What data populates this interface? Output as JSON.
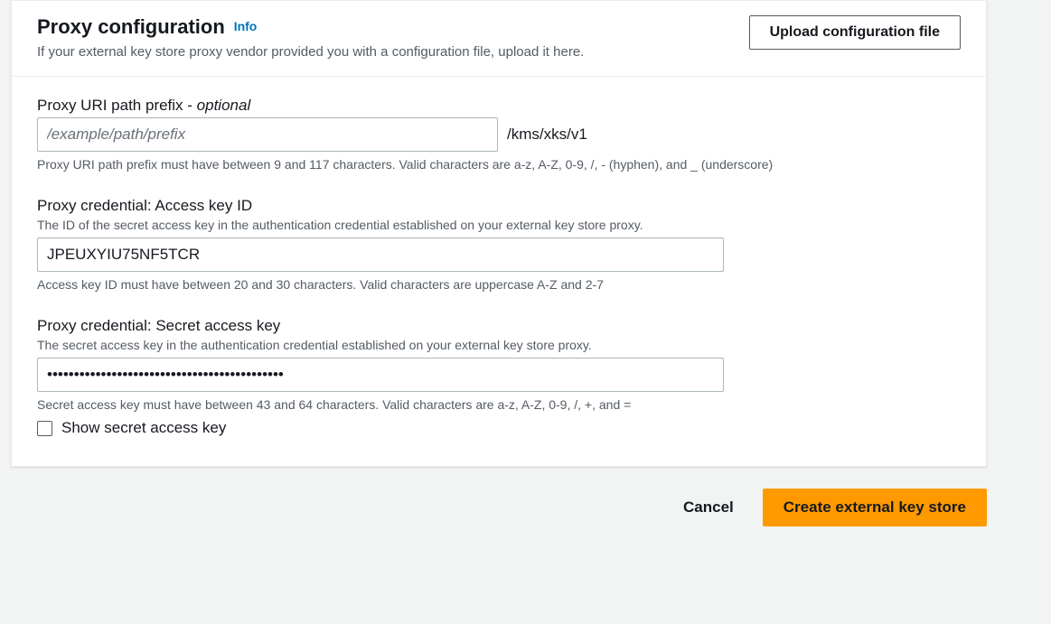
{
  "header": {
    "title": "Proxy configuration",
    "info_label": "Info",
    "subtitle": "If your external key store proxy vendor provided you with a configuration file, upload it here.",
    "upload_label": "Upload configuration file"
  },
  "fields": {
    "uri_prefix": {
      "label": "Proxy URI path prefix - ",
      "optional": "optional",
      "placeholder": "/example/path/prefix",
      "value": "",
      "suffix": "/kms/xks/v1",
      "hint": "Proxy URI path prefix must have between 9 and 117 characters. Valid characters are a-z, A-Z, 0-9, /, - (hyphen), and _ (underscore)"
    },
    "access_key": {
      "label": "Proxy credential: Access key ID",
      "desc": "The ID of the secret access key in the authentication credential established on your external key store proxy.",
      "value": "JPEUXYIU75NF5TCR",
      "hint": "Access key ID must have between 20 and 30 characters. Valid characters are uppercase A-Z and 2-7"
    },
    "secret_key": {
      "label": "Proxy credential: Secret access key",
      "desc": "The secret access key in the authentication credential established on your external key store proxy.",
      "value": "••••••••••••••••••••••••••••••••••••••••••••",
      "hint": "Secret access key must have between 43 and 64 characters. Valid characters are a-z, A-Z, 0-9, /, +, and =",
      "show_label": "Show secret access key"
    }
  },
  "footer": {
    "cancel": "Cancel",
    "create": "Create external key store"
  },
  "colors": {
    "accent": "#ff9900",
    "link": "#0073bb",
    "border": "#aab7b8"
  }
}
